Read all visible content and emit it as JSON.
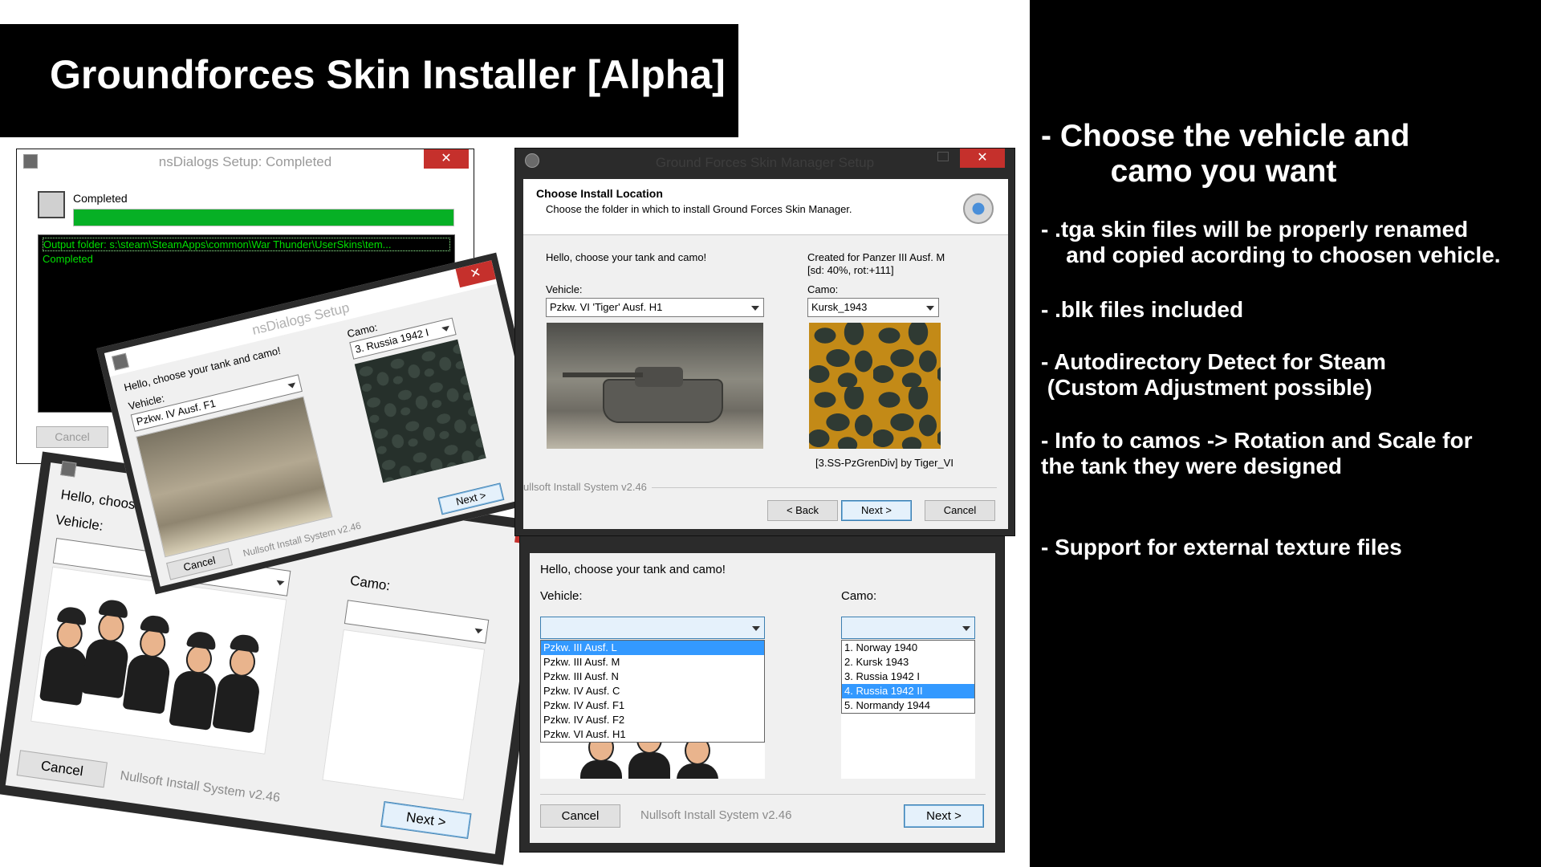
{
  "title": "Groundforces Skin Installer [Alpha]",
  "features": [
    "- Choose the vehicle and\n        camo you want",
    "- .tga skin files will be properly renamed\n    and copied acording to choosen vehicle.",
    "- .blk files included",
    "- Autodirectory Detect for Steam\n (Custom Adjustment possible)",
    "- Info to camos -> Rotation and Scale for\nthe tank they were designed",
    "- Support for external texture files"
  ],
  "win_completed": {
    "title": "nsDialogs Setup: Completed",
    "status": "Completed",
    "progress": 1.0,
    "log": [
      "Output folder: s:\\steam\\SteamApps\\common\\War Thunder\\UserSkins\\tem...",
      "Completed"
    ],
    "cancel": "Cancel"
  },
  "win_pz4": {
    "title": "nsDialogs Setup",
    "prompt": "Hello, choose your tank and camo!",
    "vehicle_label": "Vehicle:",
    "vehicle_value": "Pzkw. IV Ausf. F1",
    "camo_label": "Camo:",
    "camo_value": "3. Russia 1942 I",
    "footer": "Nullsoft Install System v2.46",
    "cancel": "Cancel",
    "next": "Next >"
  },
  "win_comic": {
    "prompt": "Hello, choose yo",
    "vehicle_label": "Vehicle:",
    "camo_label": "Camo:",
    "footer": "Nullsoft Install System v2.46",
    "cancel": "Cancel",
    "next": "Next >"
  },
  "win_main": {
    "title": "Ground Forces Skin Manager Setup",
    "heading": "Choose Install Location",
    "subheading": "Choose the folder in which to install Ground Forces Skin Manager.",
    "prompt": "Hello, choose your tank and camo!",
    "created_for": "Created for Panzer III Ausf. M",
    "camo_info": "[sd: 40%, rot:+111]",
    "vehicle_label": "Vehicle:",
    "vehicle_value": "Pzkw. VI 'Tiger' Ausf. H1",
    "camo_label": "Camo:",
    "camo_value": "Kursk_1943",
    "author": "[3.SS-PzGrenDiv] by Tiger_VI",
    "footer": "ullsoft Install System v2.46",
    "back": "< Back",
    "next": "Next >",
    "cancel": "Cancel"
  },
  "win_dropdown": {
    "prompt": "Hello, choose your tank and camo!",
    "vehicle_label": "Vehicle:",
    "camo_label": "Camo:",
    "vehicles": [
      "Pzkw. III Ausf. L",
      "Pzkw. III Ausf. M",
      "Pzkw. III Ausf. N",
      "Pzkw. IV Ausf. C",
      "Pzkw. IV Ausf. F1",
      "Pzkw. IV Ausf. F2",
      "Pzkw. VI Ausf. H1"
    ],
    "vehicle_selected": 0,
    "camos": [
      "1. Norway 1940",
      "2. Kursk 1943",
      "3. Russia 1942 I",
      "4. Russia 1942 II",
      "5. Normandy 1944"
    ],
    "camo_selected": 3,
    "footer": "Nullsoft Install System v2.46",
    "cancel": "Cancel",
    "next": "Next >"
  }
}
